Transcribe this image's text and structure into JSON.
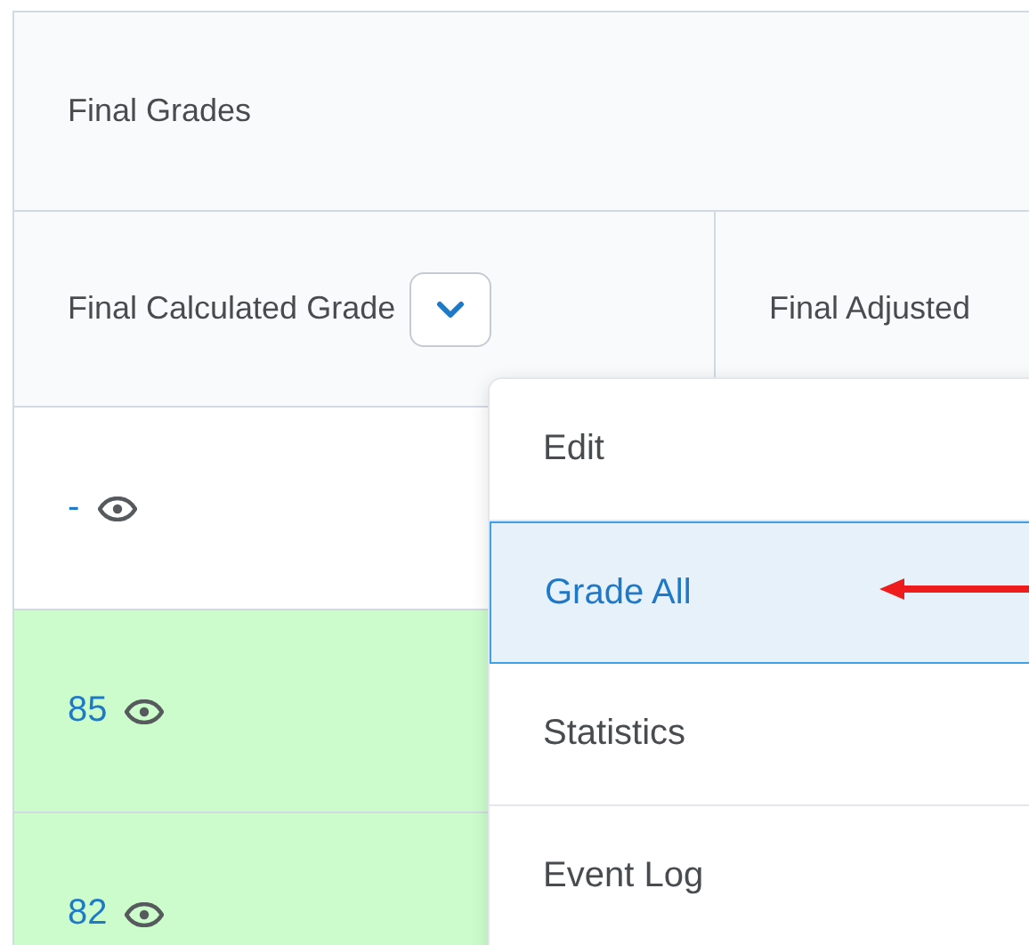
{
  "table": {
    "group_header": "Final Grades",
    "columns": [
      {
        "label": "Final Calculated Grade",
        "has_menu": true
      },
      {
        "label": "Final Adjusted",
        "has_menu": false
      }
    ],
    "rows": [
      {
        "grade": "-",
        "highlighted": false
      },
      {
        "grade": "85",
        "highlighted": true
      },
      {
        "grade": "82",
        "highlighted": true
      }
    ]
  },
  "menu": {
    "items": [
      {
        "label": "Edit",
        "selected": false
      },
      {
        "label": "Grade All",
        "selected": true
      },
      {
        "label": "Statistics",
        "selected": false
      },
      {
        "label": "Event Log",
        "selected": false
      }
    ]
  }
}
